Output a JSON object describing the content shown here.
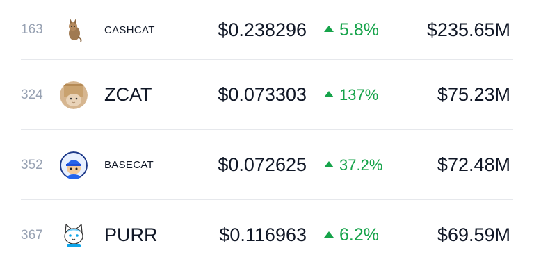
{
  "rows": [
    {
      "rank": "163",
      "name": "CASHCAT",
      "price": "$0.238296",
      "change": "5.8%",
      "market_cap": "$235.65M",
      "avatar": "cat-icon"
    },
    {
      "rank": "324",
      "name": "ZCAT",
      "price": "$0.073303",
      "change": "137%",
      "market_cap": "$75.23M",
      "avatar": "box-cat-icon"
    },
    {
      "rank": "352",
      "name": "BASECAT",
      "price": "$0.072625",
      "change": "37.2%",
      "market_cap": "$72.48M",
      "avatar": "blue-cat-icon"
    },
    {
      "rank": "367",
      "name": "PURR",
      "price": "$0.116963",
      "change": "6.2%",
      "market_cap": "$69.59M",
      "avatar": "white-cat-icon"
    }
  ],
  "colors": {
    "positive": "#16a34a",
    "rank": "#98a2b3",
    "divider": "#e6e8ec"
  }
}
